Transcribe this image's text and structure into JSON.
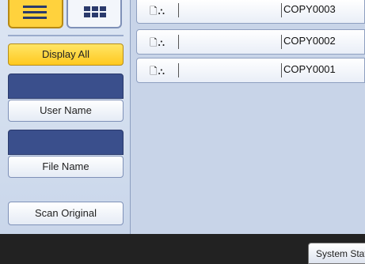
{
  "sidebar": {
    "view_list_icon": "list-view-icon",
    "view_thumb_icon": "thumbnail-view-icon",
    "display_all": "Display All",
    "user_name": "User Name",
    "file_name": "File Name",
    "scan_original": "Scan Original"
  },
  "files": [
    {
      "icons": "🗋⛬",
      "name": "COPY0003"
    },
    {
      "icons": "🗋⛬",
      "name": "COPY0002"
    },
    {
      "icons": "🗋⛬",
      "name": "COPY0001"
    }
  ],
  "bottom": {
    "system_status": "System Status"
  }
}
